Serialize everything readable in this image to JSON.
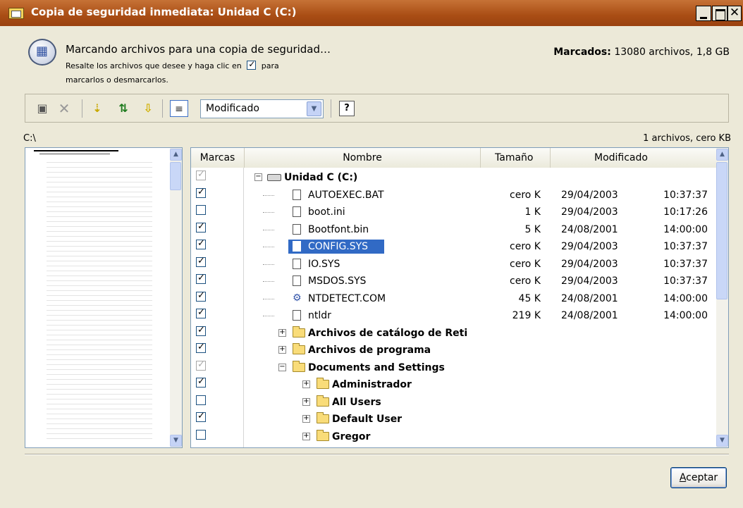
{
  "window": {
    "title": "Copia de seguridad inmediata: Unidad C (C:)"
  },
  "header": {
    "main": "Marcando archivos para una copia de seguridad…",
    "sub_before": "Resalte los archivos que desee y haga clic en",
    "sub_after": "para",
    "sub2": "marcarlos o desmarcarlos.",
    "marked_label": "Marcados:",
    "marked_value": "13080 archivos, 1,8 GB"
  },
  "toolbar": {
    "view_select": "Modificado",
    "help": "?"
  },
  "path": "C:\\",
  "count": "1 archivos, cero KB",
  "columns": {
    "marks": "Marcas",
    "name": "Nombre",
    "size": "Tamaño",
    "modified": "Modificado"
  },
  "rows": [
    {
      "name": "Unidad C (C:)",
      "kind": "drive",
      "mark": "gray"
    },
    {
      "name": "AUTOEXEC.BAT",
      "kind": "file",
      "mark": "on",
      "size": "cero K",
      "date": "29/04/2003",
      "time": "10:37:37"
    },
    {
      "name": "boot.ini",
      "kind": "file",
      "mark": "off",
      "size": "1 K",
      "date": "29/04/2003",
      "time": "10:17:26"
    },
    {
      "name": "Bootfont.bin",
      "kind": "file",
      "mark": "on",
      "size": "5 K",
      "date": "24/08/2001",
      "time": "14:00:00"
    },
    {
      "name": "CONFIG.SYS",
      "kind": "file",
      "mark": "on",
      "size": "cero K",
      "date": "29/04/2003",
      "time": "10:37:37",
      "selected": true
    },
    {
      "name": "IO.SYS",
      "kind": "file",
      "mark": "on",
      "size": "cero K",
      "date": "29/04/2003",
      "time": "10:37:37"
    },
    {
      "name": "MSDOS.SYS",
      "kind": "file",
      "mark": "on",
      "size": "cero K",
      "date": "29/04/2003",
      "time": "10:37:37"
    },
    {
      "name": "NTDETECT.COM",
      "kind": "gear",
      "mark": "on",
      "size": "45 K",
      "date": "24/08/2001",
      "time": "14:00:00"
    },
    {
      "name": "ntldr",
      "kind": "file",
      "mark": "on",
      "size": "219 K",
      "date": "24/08/2001",
      "time": "14:00:00"
    },
    {
      "name": "Archivos de catálogo de Reti",
      "kind": "folder",
      "mark": "on"
    },
    {
      "name": "Archivos de programa",
      "kind": "folder",
      "mark": "on"
    },
    {
      "name": "Documents and Settings",
      "kind": "folder-open",
      "mark": "gray"
    },
    {
      "name": "Administrador",
      "kind": "folder",
      "mark": "on"
    },
    {
      "name": "All Users",
      "kind": "folder",
      "mark": "off"
    },
    {
      "name": "Default User",
      "kind": "folder",
      "mark": "on"
    },
    {
      "name": "Gregor",
      "kind": "folder",
      "mark": "off"
    }
  ],
  "buttons": {
    "accept_underlined": "A",
    "accept_rest": "ceptar"
  }
}
